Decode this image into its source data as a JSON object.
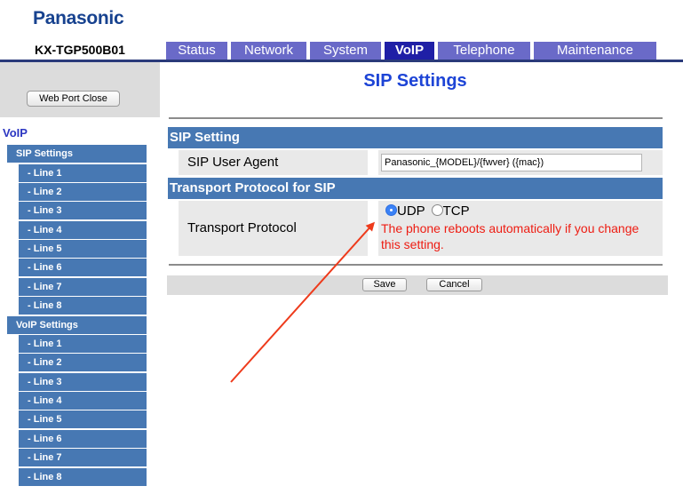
{
  "brand": "Panasonic",
  "model": "KX-TGP500B01",
  "tabs": [
    {
      "label": "Status"
    },
    {
      "label": "Network"
    },
    {
      "label": "System"
    },
    {
      "label": "VoIP"
    },
    {
      "label": "Telephone"
    },
    {
      "label": "Maintenance"
    }
  ],
  "sidebar": {
    "web_port_close": "Web Port Close",
    "section": "VoIP",
    "sip_settings": "SIP Settings",
    "sip_lines": [
      "- Line 1",
      "- Line 2",
      "- Line 3",
      "- Line 4",
      "- Line 5",
      "- Line 6",
      "- Line 7",
      "- Line 8"
    ],
    "voip_settings": "VoIP Settings",
    "voip_lines": [
      "- Line 1",
      "- Line 2",
      "- Line 3",
      "- Line 4",
      "- Line 5",
      "- Line 6",
      "- Line 7",
      "- Line 8"
    ]
  },
  "main": {
    "title": "SIP Settings",
    "sip_setting_header": "SIP Setting",
    "sip_user_agent_label": "SIP User Agent",
    "sip_user_agent_value": "Panasonic_{MODEL}/{fwver} ({mac})",
    "transport_header": "Transport Protocol for SIP",
    "transport_label": "Transport Protocol",
    "udp_label": "UDP",
    "tcp_label": "TCP",
    "selected_protocol": "UDP",
    "reboot_note_line1": "The phone reboots automatically if you change",
    "reboot_note_line2": "this setting.",
    "save": "Save",
    "cancel": "Cancel"
  },
  "colors": {
    "brand": "#17428f",
    "active_tab": "#1f1fa6",
    "tab": "#6a6ac8",
    "section_blue": "#4778b3",
    "title_blue": "#1d44d6",
    "warning_red": "#ee1c12",
    "annotation_arrow": "#ee3b1c"
  }
}
